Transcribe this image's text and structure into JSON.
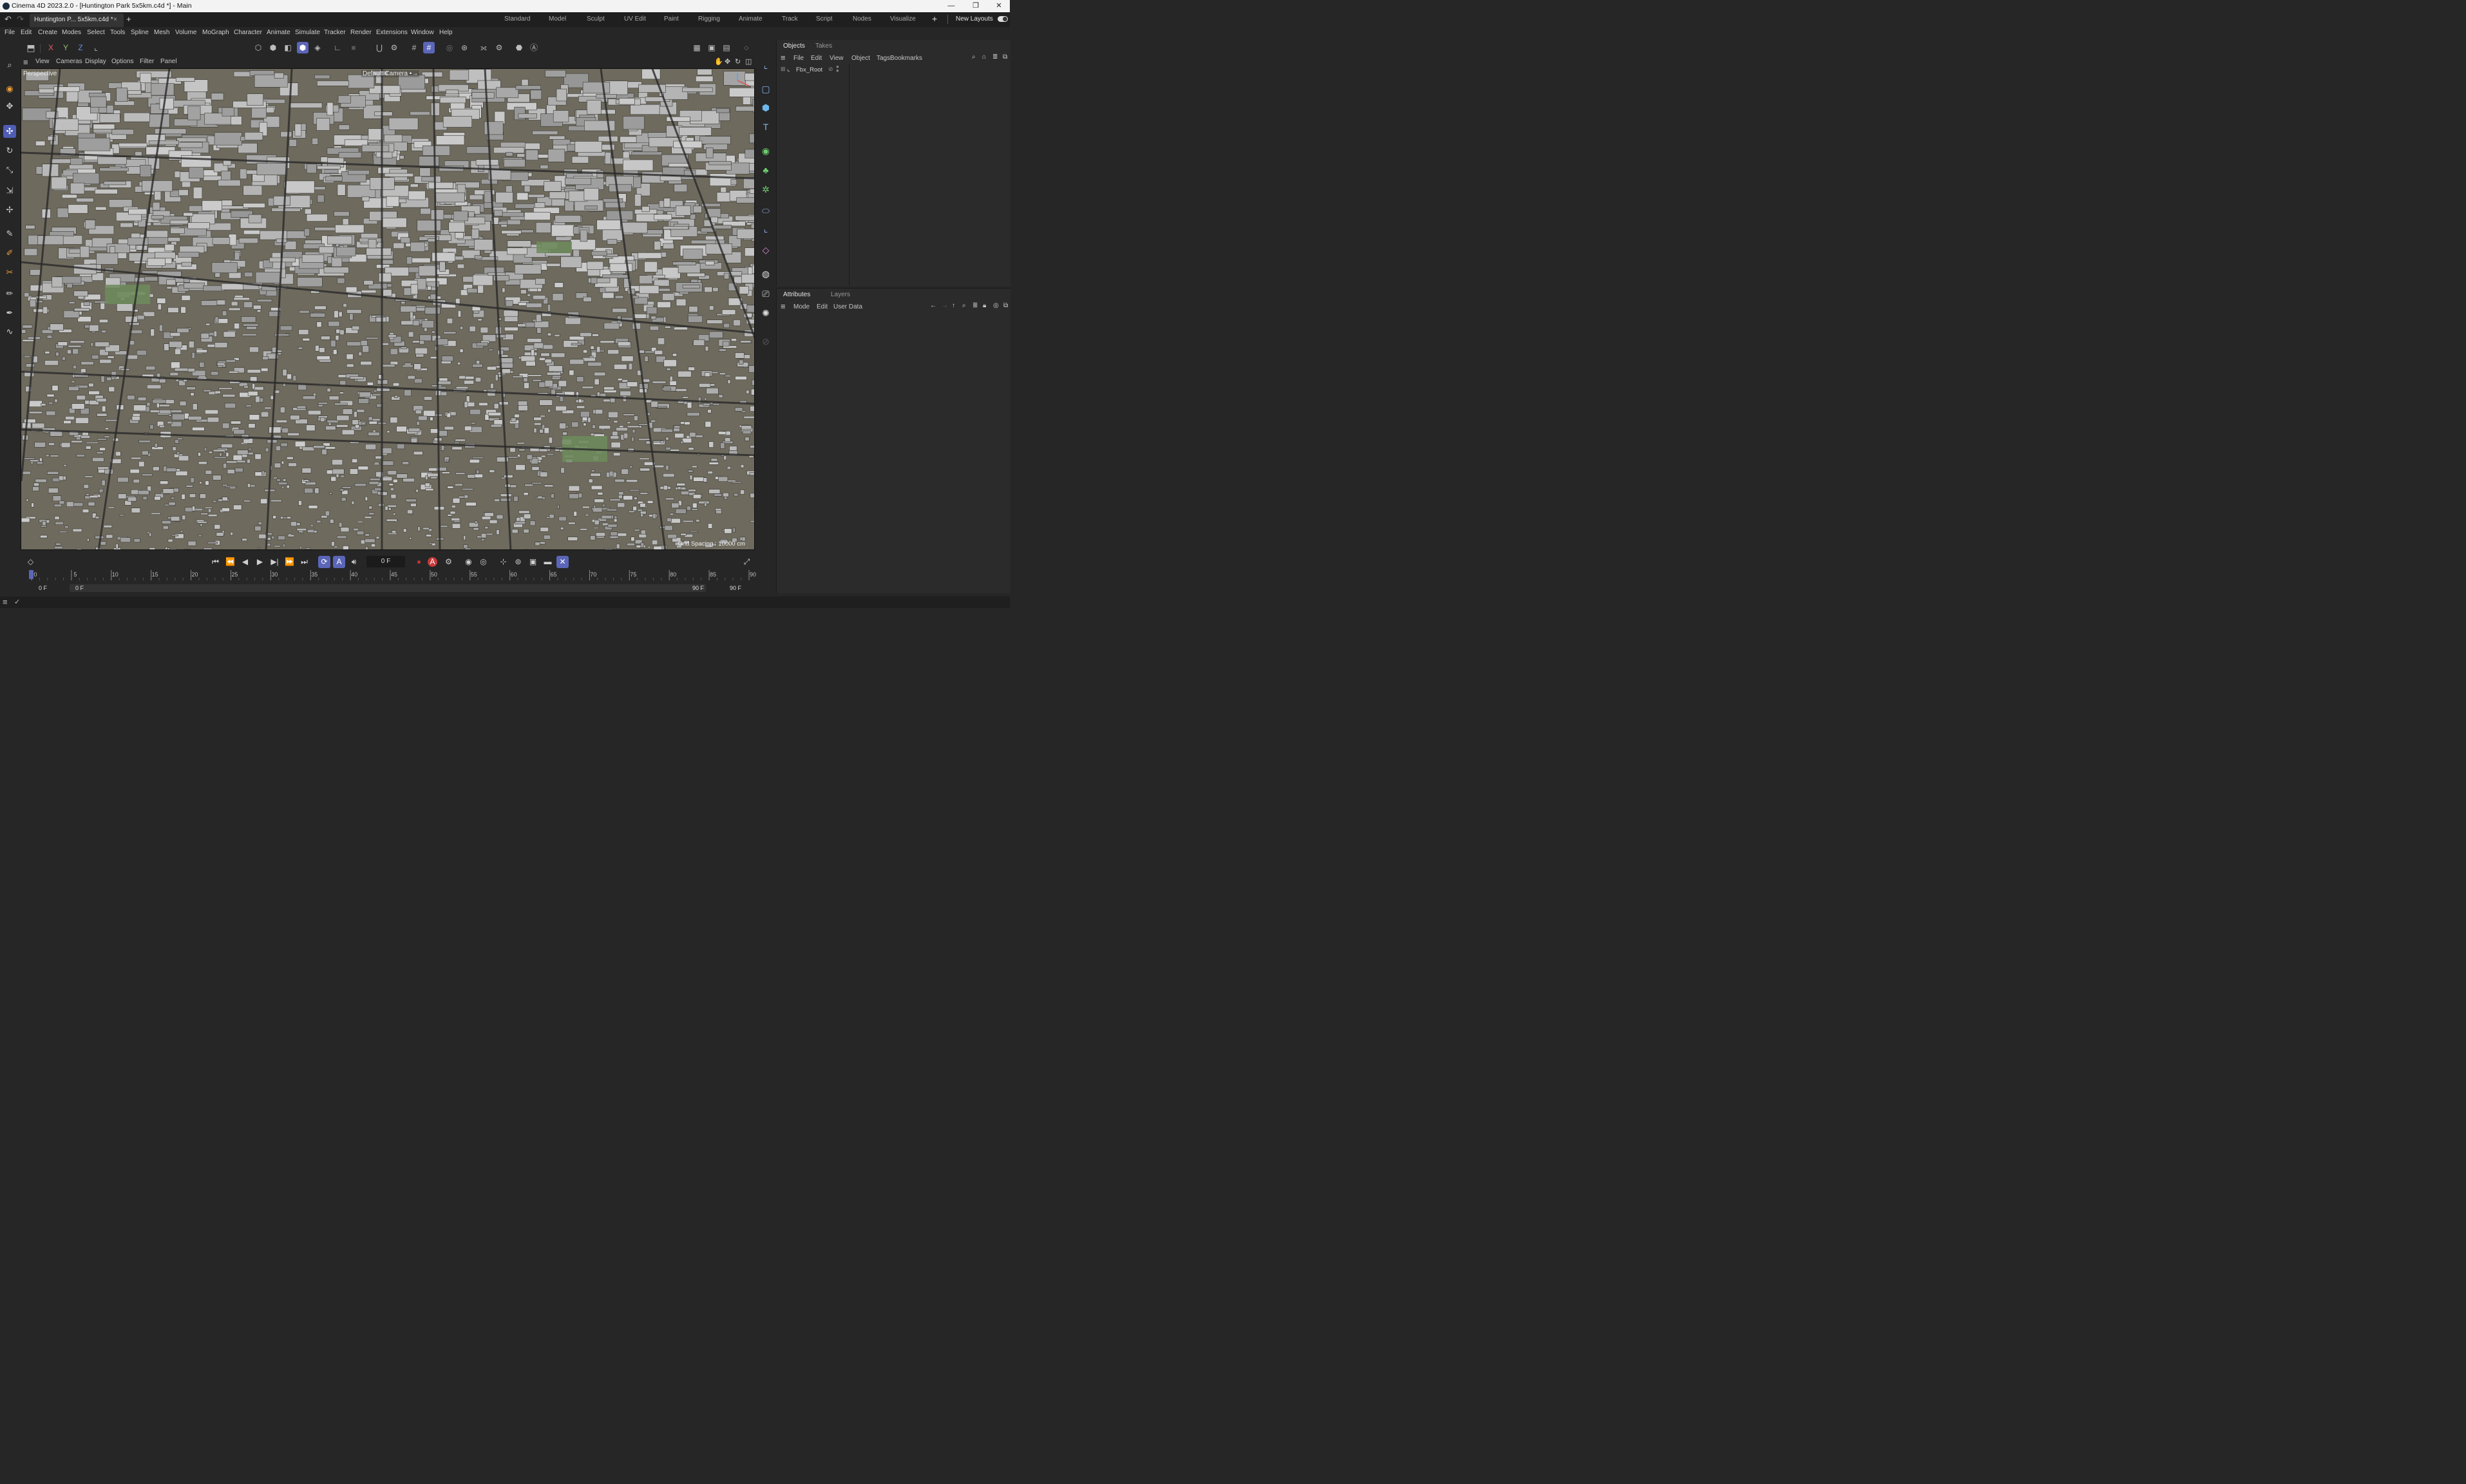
{
  "window": {
    "title": "Cinema 4D 2023.2.0 - [Huntington Park 5x5km.c4d *] - Main",
    "controls": [
      "—",
      "❐",
      "✕"
    ]
  },
  "tabs": {
    "document": "Huntington P... 5x5km.c4d *",
    "close": "×",
    "add": "+"
  },
  "layouts": {
    "items": [
      "Standard",
      "Model",
      "Sculpt",
      "UV Edit",
      "Paint",
      "Rigging",
      "Animate",
      "Track",
      "Script",
      "Nodes",
      "Visualize"
    ],
    "add": "+",
    "new_layouts": "New Layouts"
  },
  "menubar": [
    "File",
    "Edit",
    "Create",
    "Modes",
    "Select",
    "Tools",
    "Spline",
    "Mesh",
    "Volume",
    "MoGraph",
    "Character",
    "Animate",
    "Simulate",
    "Tracker",
    "Render",
    "Extensions",
    "Window",
    "Help"
  ],
  "toolbar": {
    "axes": [
      "X",
      "Y",
      "Z"
    ]
  },
  "viewport": {
    "menu": [
      "View",
      "Cameras",
      "Display",
      "Options",
      "Filter",
      "Panel"
    ],
    "label": "Perspective",
    "camera": "Default Camera •→",
    "grid_spacing": "Grid Spacing : 10000 cm"
  },
  "objects_panel": {
    "tabs": [
      "Objects",
      "Takes"
    ],
    "menu": [
      "File",
      "Edit",
      "View",
      "Object",
      "Tags",
      "Bookmarks"
    ],
    "root_object": "Fbx_Root"
  },
  "attributes_panel": {
    "tabs": [
      "Attributes",
      "Layers"
    ],
    "menu": [
      "Mode",
      "Edit",
      "User Data"
    ]
  },
  "timeline": {
    "current_frame": "0 F",
    "ticks": [
      "0",
      "5",
      "10",
      "15",
      "20",
      "25",
      "30",
      "35",
      "40",
      "45",
      "50",
      "55",
      "60",
      "65",
      "70",
      "75",
      "80",
      "85",
      "90"
    ],
    "range_start_outer": "0 F",
    "range_start_inner": "0 F",
    "range_end_inner": "90 F",
    "range_end_outer": "90 F"
  },
  "colors": {
    "accent": "#5b66b8",
    "viewport_ground": "#6e6a5d",
    "building": "#b3b3b3",
    "park": "#6d8b5a",
    "road": "#2a2a2a"
  }
}
